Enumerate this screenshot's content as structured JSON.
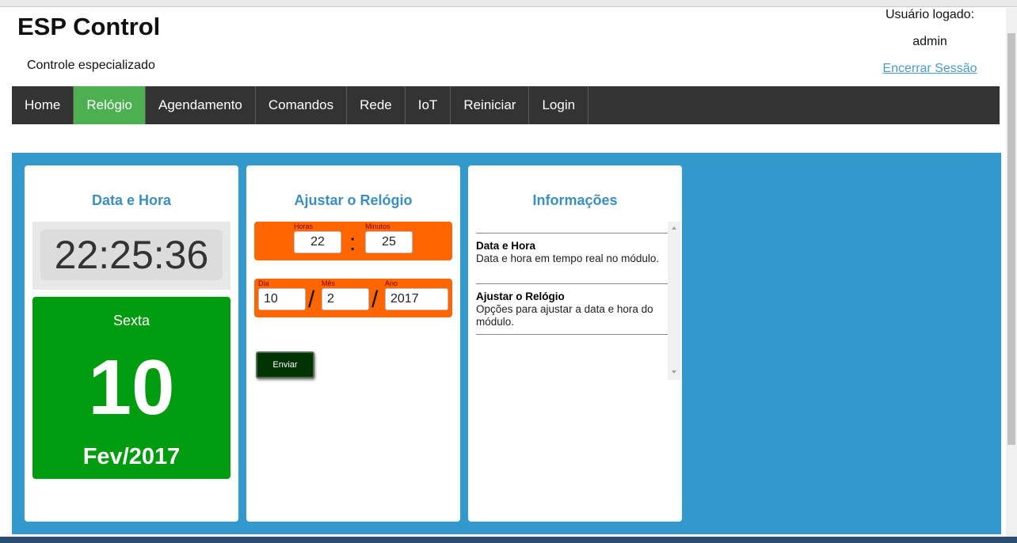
{
  "header": {
    "title": "ESP Control",
    "subtitle": "Controle especializado",
    "user_label": "Usuário logado:",
    "user_name": "admin",
    "logout": "Encerrar Sessão"
  },
  "nav": {
    "items": [
      {
        "label": "Home"
      },
      {
        "label": "Relógio"
      },
      {
        "label": "Agendamento"
      },
      {
        "label": "Comandos"
      },
      {
        "label": "Rede"
      },
      {
        "label": "IoT"
      },
      {
        "label": "Reiniciar"
      },
      {
        "label": "Login"
      }
    ],
    "active": "Relógio"
  },
  "clock_card": {
    "title": "Data e Hora",
    "time": "22:25:36",
    "weekday": "Sexta",
    "day": "10",
    "month_year": "Fev/2017"
  },
  "adjust_card": {
    "title": "Ajustar o Relógio",
    "hours_label": "Horas",
    "hours_value": "22",
    "minutes_label": "Minutos",
    "minutes_value": "25",
    "time_separator": ":",
    "day_label": "Dia",
    "day_value": "10",
    "month_label": "Mês",
    "month_value": "2",
    "year_label": "Ano",
    "year_value": "2017",
    "date_separator": "/",
    "send_button": "Enviar"
  },
  "info_card": {
    "title": "Informações",
    "items": [
      {
        "title": "Data e Hora",
        "text": "Data e hora em tempo real no módulo."
      },
      {
        "title": "Ajustar o Relógio",
        "text": "Opções para ajustar a data e hora do módulo."
      }
    ]
  },
  "colors": {
    "nav_bg": "#333333",
    "nav_active": "#4caf50",
    "panel_bg": "#3399cc",
    "title_blue": "#3a8fc0",
    "orange": "#ff6600",
    "date_green": "#009c0f",
    "button_dark": "#003300"
  }
}
